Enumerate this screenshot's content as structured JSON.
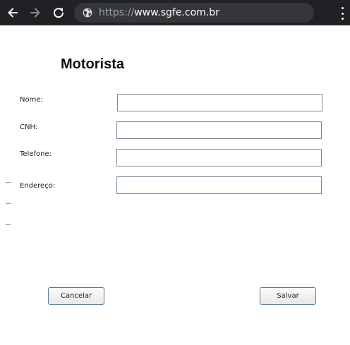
{
  "browser": {
    "url_scheme": "https://",
    "url_host": "www.sgfe.com.br",
    "icons": {
      "back": "arrow-left-icon",
      "forward": "arrow-right-icon",
      "reload": "reload-icon",
      "site_info": "globe-icon",
      "menu": "kebab-menu-icon"
    }
  },
  "form": {
    "title": "Motorista",
    "fields": [
      {
        "label": "Nome:",
        "value": ""
      },
      {
        "label": "CNH:",
        "value": ""
      },
      {
        "label": "Telefone:",
        "value": ""
      },
      {
        "label": "Endereço:",
        "value": ""
      }
    ],
    "buttons": {
      "cancel": "Cancelar",
      "save": "Salvar"
    }
  }
}
